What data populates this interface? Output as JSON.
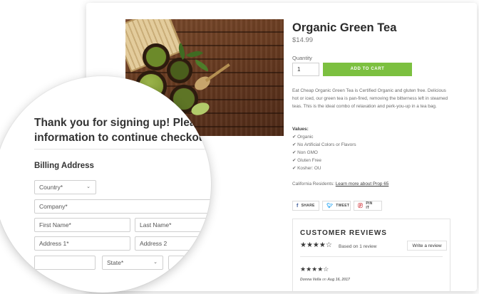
{
  "product": {
    "title": "Organic Green Tea",
    "price": "$14.99",
    "quantity_label": "Quantity",
    "quantity_value": "1",
    "add_to_cart": "ADD TO CART",
    "description": "Eat Cheap Organic Green Tea is Certified Organic and gluten free. Delicious hot or iced, our green tea is pan-fired, removing the bitterness left in steamed teas. This is the ideal combo of relaxation and perk-you-up in a tea bag.",
    "values_title": "Values:",
    "values": [
      "✔ Organic",
      "✔ No Artificial Colors or Flavors",
      "✔ Non GMO",
      "✔ Gluten Free",
      "✔ Kosher: OU"
    ],
    "ca_text": "California Residents:",
    "ca_link": "Learn more about Prop 65"
  },
  "share": {
    "facebook": "SHARE",
    "twitter": "TWEET",
    "pinterest": "PIN IT"
  },
  "reviews": {
    "title": "CUSTOMER REVIEWS",
    "stars": "★★★★☆",
    "based_on": "Based on 1 review",
    "write_review": "Write a review",
    "review_stars": "★★★★☆",
    "review_author": "Donna Vella",
    "review_on": "on",
    "review_date": "Aug 16, 2017"
  },
  "checkout": {
    "heading_line1": "Thank you for signing up! Please",
    "heading_line2": "information to continue checkout",
    "billing_title": "Billing Address",
    "country_placeholder": "Country*",
    "company_placeholder": "Company*",
    "first_name_placeholder": "First Name*",
    "last_name_placeholder": "Last Name*",
    "address1_placeholder": "Address 1*",
    "address2_placeholder": "Address 2",
    "state_placeholder": "State*"
  },
  "colors": {
    "accent_green": "#7cc040"
  }
}
